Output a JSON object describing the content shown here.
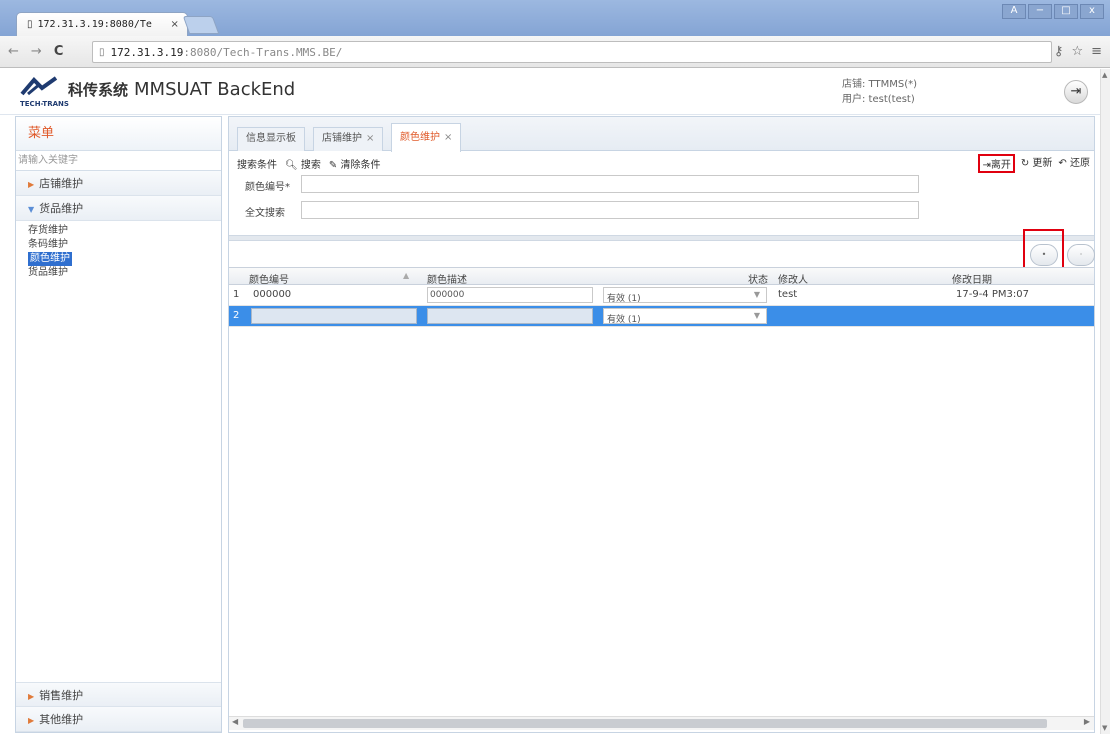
{
  "browser": {
    "tab_title": "172.31.3.19:8080/Te",
    "tab_close": "×",
    "url_main": "172.31.3.19",
    "url_rest": ":8080/Tech-Trans.MMS.BE/",
    "nav_back": "←",
    "nav_forward": "→",
    "nav_reload": "C",
    "win_btns": [
      "A",
      "−",
      "□",
      "x"
    ]
  },
  "app": {
    "logo_text": "TECH-TRANS",
    "title_cn": "科传系统",
    "title_en": "MMSUAT BackEnd",
    "store": "店铺: TTMMS(*)",
    "user": "用户: test(test)"
  },
  "sidebar": {
    "title": "菜单",
    "search_placeholder": "请输入关键字",
    "groups": [
      {
        "label": "店铺维护"
      },
      {
        "label": "货品维护",
        "expanded": true,
        "items": [
          "存货维护",
          "条码维护",
          "颜色维护",
          "货品维护"
        ]
      }
    ],
    "bottom_groups": [
      "销售维护",
      "其他维护"
    ],
    "selected_item": "颜色维护"
  },
  "tabs": [
    {
      "label": "信息显示板",
      "closable": false
    },
    {
      "label": "店铺维护",
      "closable": true
    },
    {
      "label": "颜色维护",
      "closable": true,
      "active": true
    }
  ],
  "search_bar": {
    "criteria": "搜索条件",
    "search": "搜索",
    "clear": "清除条件"
  },
  "actions": {
    "leave": "离开",
    "update": "更新",
    "restore": "还原"
  },
  "form": {
    "color_code_label": "颜色编号*",
    "fulltext_label": "全文搜索"
  },
  "grid": {
    "columns": [
      "颜色编号",
      "颜色描述",
      "状态",
      "修改人",
      "修改日期"
    ],
    "rows": [
      {
        "num": "1",
        "code": "000000",
        "desc": "000000",
        "status": "有效 (1)",
        "modifier": "test",
        "date": "17-9-4 PM3:07"
      },
      {
        "num": "2",
        "code": "",
        "desc": "",
        "status": "有效 (1)",
        "modifier": "",
        "date": ""
      }
    ]
  },
  "colors": {
    "accent": "#e05a2a",
    "selected_row": "#3b8ee8",
    "highlight_box": "#e0000f"
  }
}
